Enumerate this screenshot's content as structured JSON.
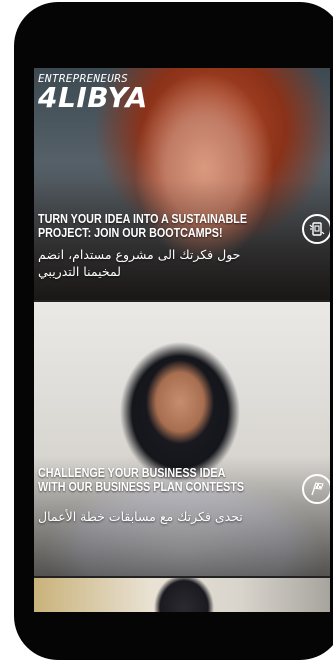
{
  "logo": {
    "line1": "ENTREPRENEURS",
    "line2": "4LIBYA"
  },
  "cards": [
    {
      "headline": "TURN YOUR IDEA INTO A SUSTAINABLE PROJECT: JOIN OUR BOOTCAMPS!",
      "arabic": "حول فكرتك الى مشروع مستدام، انضم لمخيمنا التدريبي",
      "icon": "bootcamp-icon"
    },
    {
      "headline": "CHALLENGE YOUR BUSINESS IDEA WITH OUR BUSINESS PLAN CONTESTS",
      "arabic": "تحدى فكرتك مع مسابقات خطة الأعمال",
      "icon": "checkered-flag-icon"
    }
  ],
  "colors": {
    "frame": "#050505",
    "text": "#ffffff"
  }
}
